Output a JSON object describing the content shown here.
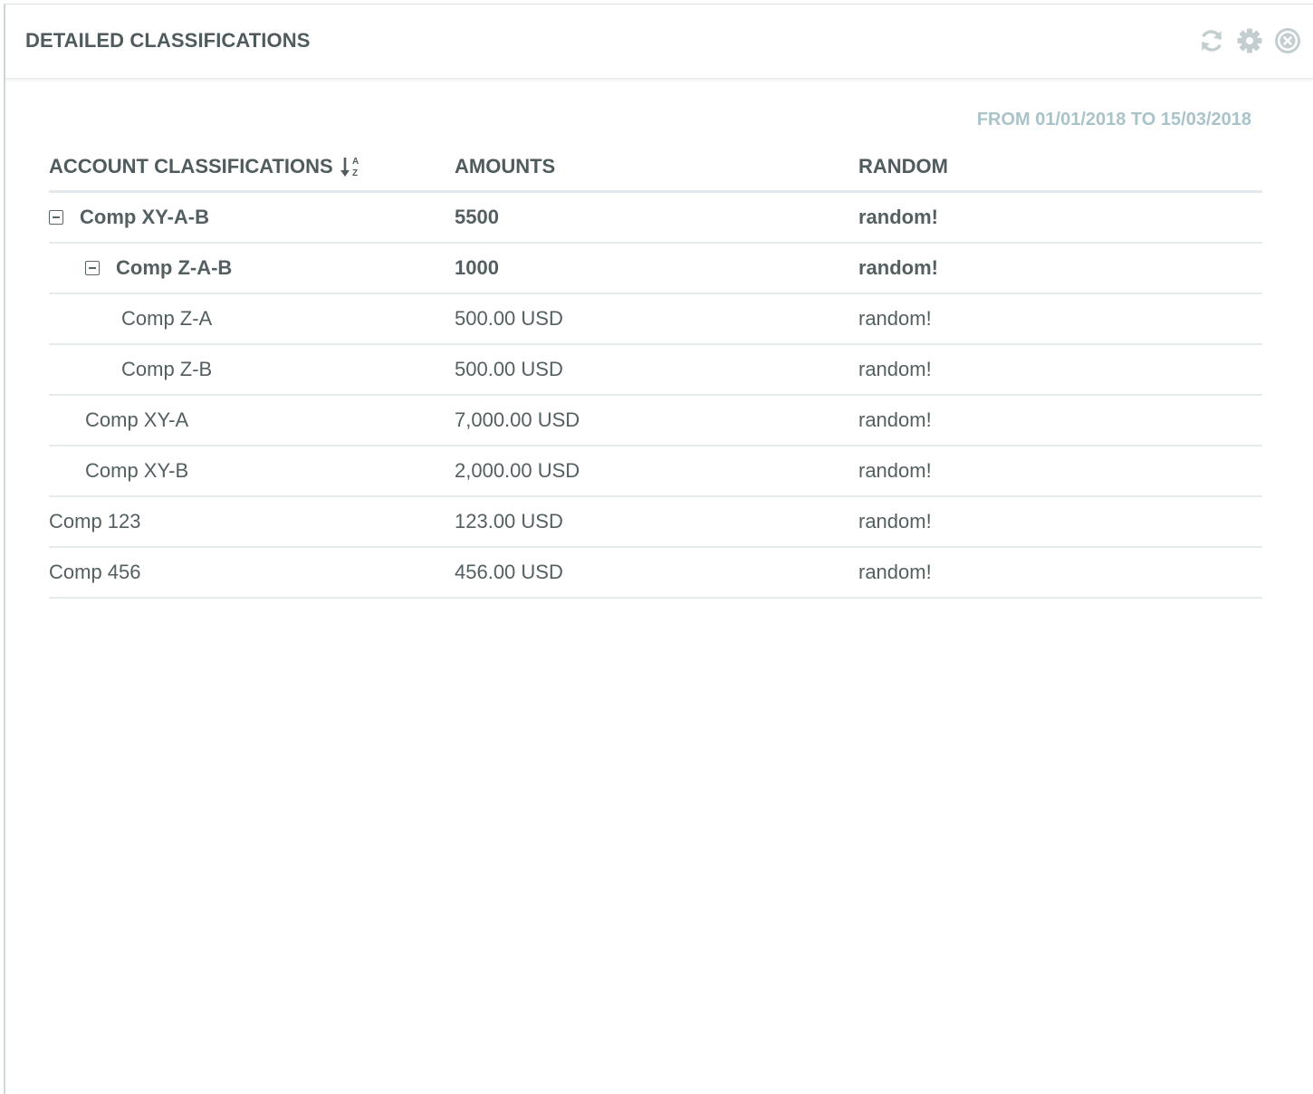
{
  "widget": {
    "title": "DETAILED CLASSIFICATIONS",
    "tools": [
      "refresh-icon",
      "gear-icon",
      "close-icon"
    ]
  },
  "date_range": "FROM 01/01/2018 TO 15/03/2018",
  "table": {
    "headers": {
      "classification": "ACCOUNT CLASSIFICATIONS",
      "amounts": "AMOUNTS",
      "random": "RANDOM"
    },
    "sort_icon": "sort-alpha-asc-icon",
    "rows": [
      {
        "name": "Comp XY-A-B",
        "amount": "5500",
        "random": "random!",
        "level": 0,
        "group": true,
        "expanded": true
      },
      {
        "name": "Comp Z-A-B",
        "amount": "1000",
        "random": "random!",
        "level": 1,
        "group": true,
        "expanded": true
      },
      {
        "name": "Comp Z-A",
        "amount": "500.00 USD",
        "random": "random!",
        "level": 2,
        "group": false
      },
      {
        "name": "Comp Z-B",
        "amount": "500.00 USD",
        "random": "random!",
        "level": 2,
        "group": false
      },
      {
        "name": "Comp XY-A",
        "amount": "7,000.00 USD",
        "random": "random!",
        "level": 1,
        "group": false
      },
      {
        "name": "Comp XY-B",
        "amount": "2,000.00 USD",
        "random": "random!",
        "level": 1,
        "group": false
      },
      {
        "name": "Comp 123",
        "amount": "123.00 USD",
        "random": "random!",
        "level": 0,
        "group": false
      },
      {
        "name": "Comp 456",
        "amount": "456.00 USD",
        "random": "random!",
        "level": 0,
        "group": false
      }
    ]
  },
  "colors": {
    "text": "#545f61",
    "heading": "#4f5b5d",
    "date": "#a9c3c9",
    "icons": "#c4cdcf",
    "rule": "#e6ebec"
  }
}
